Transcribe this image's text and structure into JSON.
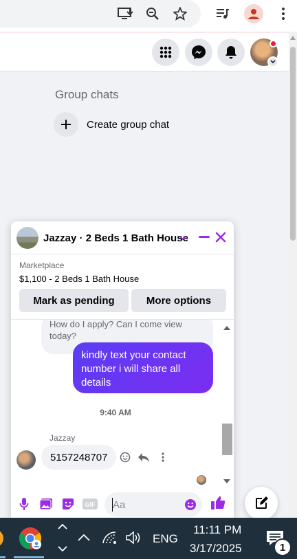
{
  "browser": {
    "toolbar_icons": [
      "install-app-icon",
      "zoom-icon",
      "bookmark-star-icon",
      "media-control-icon",
      "profile-icon",
      "menu-dots-icon"
    ]
  },
  "fb_header": {
    "icons": [
      "menu-grid-icon",
      "messenger-icon",
      "notifications-bell-icon"
    ]
  },
  "sidebar": {
    "group_chats_title": "Group chats",
    "create_group_label": "Create group chat"
  },
  "chat": {
    "title": "Jazzay · 2 Beds 1 Bath House",
    "marketplace_label": "Marketplace",
    "listing_price_title": "$1,100 - 2 Beds 1 Bath House",
    "mark_pending_label": "Mark as pending",
    "more_options_label": "More options",
    "messages": {
      "incoming_top": "How do I apply? Can I come view today?",
      "outgoing": "kindly text your contact number i will share all details",
      "timestamp": "9:40 AM",
      "sender_name": "Jazzay",
      "incoming_last": "5157248707"
    },
    "composer_placeholder": "Aa",
    "accent_color": "#9b2be6"
  },
  "taskbar": {
    "language": "ENG",
    "time": "11:11 PM",
    "date": "3/17/2025",
    "notification_count": "1"
  }
}
